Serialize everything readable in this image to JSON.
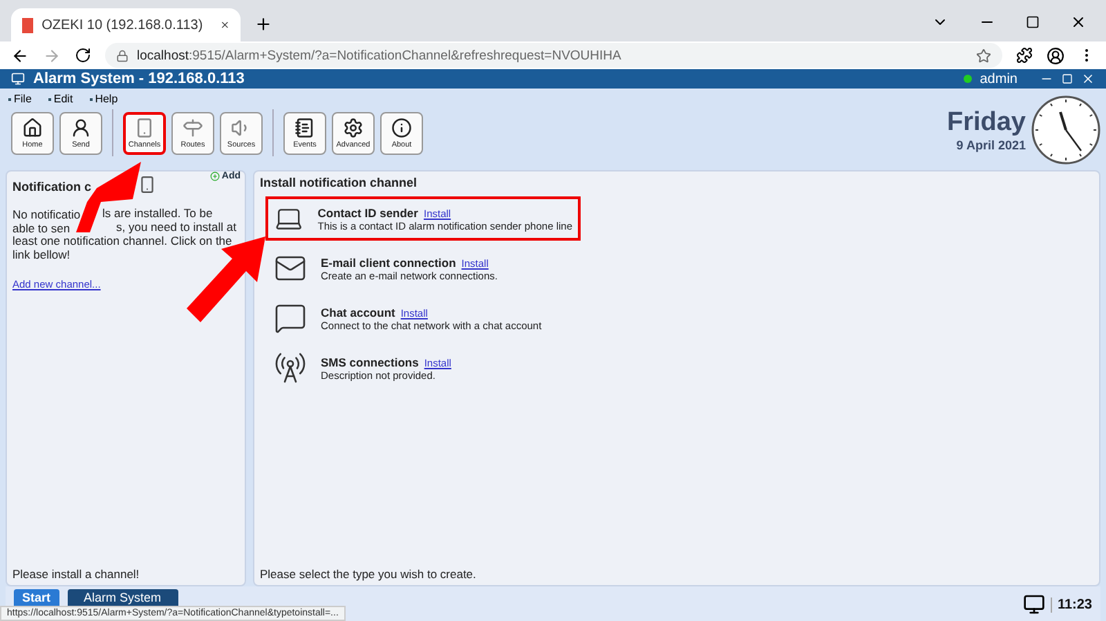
{
  "browser": {
    "tab_title": "OZEKI 10 (192.168.0.113)",
    "url_host": "localhost",
    "url_rest": ":9515/Alarm+System/?a=NotificationChannel&refreshrequest=NVOUHIHA"
  },
  "app": {
    "title": "Alarm System - 192.168.0.113",
    "user": "admin",
    "user_online": true
  },
  "menu": [
    "File",
    "Edit",
    "Help"
  ],
  "toolbar": [
    [
      {
        "kind": "home",
        "label": "Home",
        "highlighted": false
      },
      {
        "kind": "send",
        "label": "Send",
        "highlighted": false
      }
    ],
    [
      {
        "kind": "channels",
        "label": "Channels",
        "highlighted": true
      },
      {
        "kind": "routes",
        "label": "Routes",
        "highlighted": false
      },
      {
        "kind": "sources",
        "label": "Sources",
        "highlighted": false
      }
    ],
    [
      {
        "kind": "events",
        "label": "Events",
        "highlighted": false
      },
      {
        "kind": "advanced",
        "label": "Advanced",
        "highlighted": false
      },
      {
        "kind": "about",
        "label": "About",
        "highlighted": false
      }
    ]
  ],
  "date": {
    "day": "Friday",
    "date": "9 April 2021"
  },
  "left_panel": {
    "title": "Notification c",
    "add": "Add",
    "message_lines": [
      [
        "No notificatio",
        "ls are installed. To be"
      ],
      [
        "able to sen",
        "s, you need to install at"
      ],
      [
        "least one notification channel. Click on the"
      ],
      [
        "link bellow!"
      ]
    ],
    "link": "Add new channel...",
    "footer": "Please install a channel!"
  },
  "right_panel": {
    "title": "Install notification channel",
    "footer": "Please select the type you wish to create.",
    "channels": [
      {
        "kind": "contact",
        "name": "Contact ID sender",
        "action": "Install",
        "description": "This is a contact ID alarm notification sender phone line",
        "highlighted": true
      },
      {
        "kind": "email",
        "name": "E-mail client connection",
        "action": "Install",
        "description": "Create an e-mail network connections.",
        "highlighted": false
      },
      {
        "kind": "chat",
        "name": "Chat account",
        "action": "Install",
        "description": "Connect to the chat network with a chat account",
        "highlighted": false
      },
      {
        "kind": "sms",
        "name": "SMS connections",
        "action": "Install",
        "description": "Description not provided.",
        "highlighted": false
      }
    ]
  },
  "taskbar": {
    "start": "Start",
    "window": "Alarm System",
    "time": "11:23"
  },
  "status_url": "https://localhost:9515/Alarm+System/?a=NotificationChannel&typetoinstall=..."
}
